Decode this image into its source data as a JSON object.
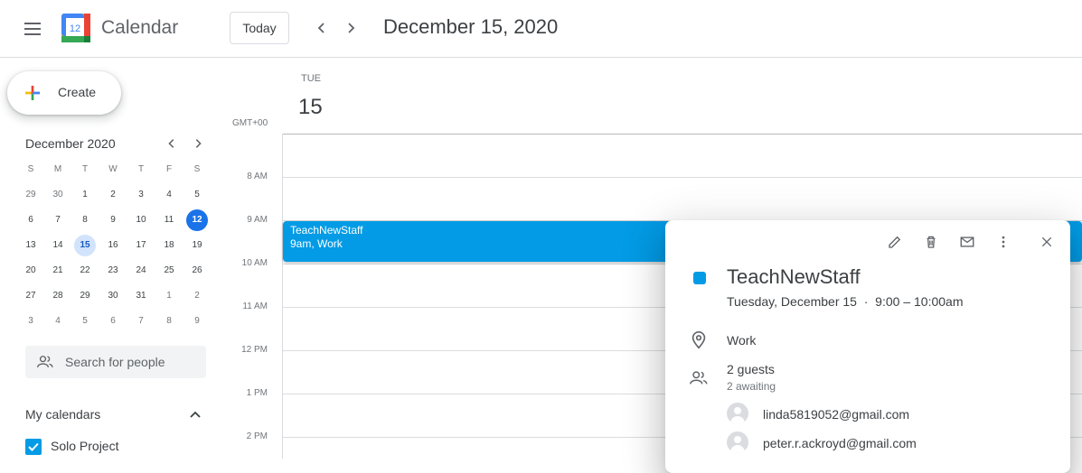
{
  "header": {
    "app_title": "Calendar",
    "logo_number": "12",
    "today_label": "Today",
    "date_title": "December 15, 2020"
  },
  "sidebar": {
    "create_label": "Create",
    "mini_calendar": {
      "month_label": "December 2020",
      "weekday_headers": [
        "S",
        "M",
        "T",
        "W",
        "T",
        "F",
        "S"
      ],
      "weeks": [
        [
          "29",
          "30",
          "1",
          "2",
          "3",
          "4",
          "5"
        ],
        [
          "6",
          "7",
          "8",
          "9",
          "10",
          "11",
          "12"
        ],
        [
          "13",
          "14",
          "15",
          "16",
          "17",
          "18",
          "19"
        ],
        [
          "20",
          "21",
          "22",
          "23",
          "24",
          "25",
          "26"
        ],
        [
          "27",
          "28",
          "29",
          "30",
          "31",
          "1",
          "2"
        ],
        [
          "3",
          "4",
          "5",
          "6",
          "7",
          "8",
          "9"
        ]
      ],
      "today": "12",
      "selected": "15"
    },
    "search_people_placeholder": "Search for people",
    "my_calendars_title": "My calendars",
    "calendars": [
      {
        "label": "Solo Project",
        "checked": true,
        "color": "#039be5"
      }
    ]
  },
  "day_view": {
    "day_name": "TUE",
    "day_number": "15",
    "timezone": "GMT+00",
    "time_labels": [
      "8 AM",
      "9 AM",
      "10 AM",
      "11 AM",
      "12 PM",
      "1 PM",
      "2 PM"
    ]
  },
  "event": {
    "title": "TeachNewStaff",
    "subtitle": "9am, Work",
    "color": "#039be5"
  },
  "popup": {
    "title": "TeachNewStaff",
    "datetime": "Tuesday, December 15  ·  9:00 – 10:00am",
    "location": "Work",
    "guests_count": "2 guests",
    "guests_status": "2 awaiting",
    "guests": [
      {
        "email": "linda5819052@gmail.com"
      },
      {
        "email": "peter.r.ackroyd@gmail.com"
      }
    ]
  },
  "colors": {
    "accent": "#1a73e8",
    "event": "#039be5"
  }
}
